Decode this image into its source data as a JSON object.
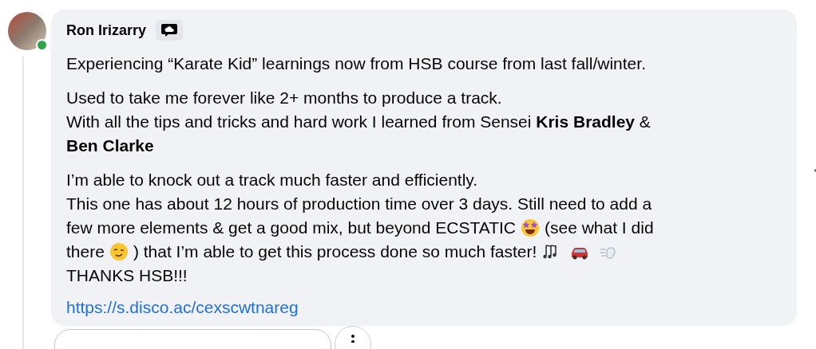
{
  "comment": {
    "author": "Ron Irizarry",
    "online": true,
    "paragraphs": [
      [
        [
          {
            "kind": "text",
            "text": "Experiencing “Karate Kid” learnings now from HSB course from last fall/winter."
          }
        ]
      ],
      [
        [
          {
            "kind": "text",
            "text": "Used to take me forever like 2+ months to produce a track."
          }
        ],
        [
          {
            "kind": "text",
            "text": "With all the tips and tricks and hard work I learned from Sensei **Kris Bradley** &"
          }
        ],
        [
          {
            "kind": "text",
            "text": "**Ben Clarke**"
          }
        ]
      ],
      [
        [
          {
            "kind": "text",
            "text": "I’m able to knock out a track much faster and efficiently."
          }
        ],
        [
          {
            "kind": "text",
            "text": "This one has about 12 hours of production time over 3 days. Still need to add a"
          }
        ],
        [
          {
            "kind": "text",
            "text": "few more elements & get a good mix, but beyond ECSTATIC"
          },
          {
            "kind": "star_face"
          },
          {
            "kind": "text",
            "text": "(see what I did"
          }
        ],
        [
          {
            "kind": "text",
            "text": "there"
          },
          {
            "kind": "wink_face"
          },
          {
            "kind": "text",
            "text": ") that I’m able to get this process done so much faster!"
          },
          {
            "kind": "notes"
          },
          {
            "kind": "car"
          },
          {
            "kind": "dash"
          }
        ],
        [
          {
            "kind": "text",
            "text": "THANKS HSB!!!"
          }
        ]
      ]
    ],
    "link": "https://s.disco.ac/cexscwtnareg"
  }
}
